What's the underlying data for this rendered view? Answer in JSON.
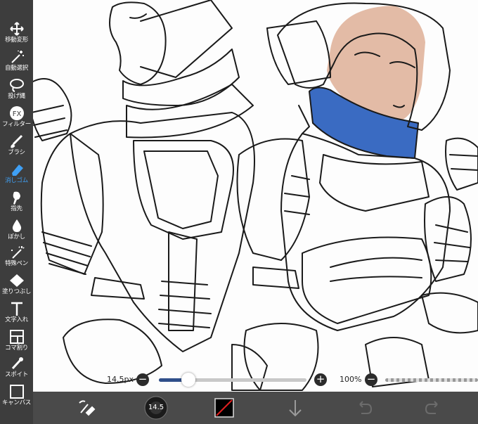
{
  "toolbar": {
    "tools": [
      {
        "id": "move",
        "label": "移動変形",
        "icon": "move-arrows-icon"
      },
      {
        "id": "auto-select",
        "label": "自動選択",
        "icon": "magic-wand-icon"
      },
      {
        "id": "lasso",
        "label": "投げ縄",
        "icon": "lasso-icon"
      },
      {
        "id": "filter",
        "label": "フィルター",
        "icon": "fx-icon"
      },
      {
        "id": "brush",
        "label": "ブラシ",
        "icon": "brush-icon"
      },
      {
        "id": "eraser",
        "label": "消しゴム",
        "icon": "eraser-icon",
        "active": true
      },
      {
        "id": "finger",
        "label": "指先",
        "icon": "finger-icon"
      },
      {
        "id": "blur",
        "label": "ぼかし",
        "icon": "drop-icon"
      },
      {
        "id": "special-pen",
        "label": "特殊ペン",
        "icon": "special-pen-icon"
      },
      {
        "id": "fill",
        "label": "塗りつぶし",
        "icon": "bucket-icon"
      },
      {
        "id": "text",
        "label": "文字入れ",
        "icon": "text-icon"
      },
      {
        "id": "frame",
        "label": "コマ割り",
        "icon": "frame-divider-icon"
      },
      {
        "id": "eyedropper",
        "label": "スポイト",
        "icon": "eyedropper-icon"
      },
      {
        "id": "canvas",
        "label": "キャンバス",
        "icon": "canvas-icon"
      }
    ],
    "active_color": "#3fa0f5"
  },
  "brush_size": {
    "value_label": "14.5px",
    "minus": "−",
    "plus": "+",
    "fraction": 0.2
  },
  "opacity": {
    "value_label": "100%",
    "minus": "−",
    "fraction": 1.0
  },
  "bottom_bar": {
    "brush_size_label": "14.5",
    "layer_color": "#000000"
  },
  "colors": {
    "skin": "#e3bba6",
    "scarf": "#3a6bc2"
  }
}
